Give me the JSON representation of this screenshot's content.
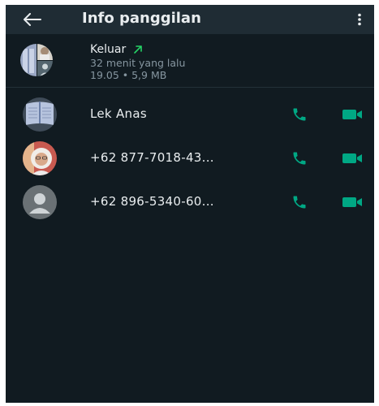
{
  "header": {
    "title": "Info panggilan",
    "back_icon": "arrow-left-icon",
    "menu_icon": "more-vertical-icon"
  },
  "call_summary": {
    "status": "Keluar",
    "direction_icon": "outgoing-arrow-icon",
    "time_ago": "32 menit yang lalu",
    "details": "19.05 • 5,9 MB"
  },
  "participants": [
    {
      "name": "Lek Anas",
      "avatar": "photo-avatar"
    },
    {
      "name": "+62 877-7018-43...",
      "avatar": "photo-avatar"
    },
    {
      "name": "+62 896-5340-60...",
      "avatar": "default-person-avatar"
    }
  ],
  "actions": {
    "voice_icon": "phone-icon",
    "video_icon": "video-camera-icon"
  },
  "colors": {
    "background": "#111b21",
    "appbar": "#1f2c34",
    "accent_green": "#00a884",
    "outgoing_arrow": "#25d366",
    "secondary_text": "#8696a0",
    "primary_text": "#e9edef"
  }
}
